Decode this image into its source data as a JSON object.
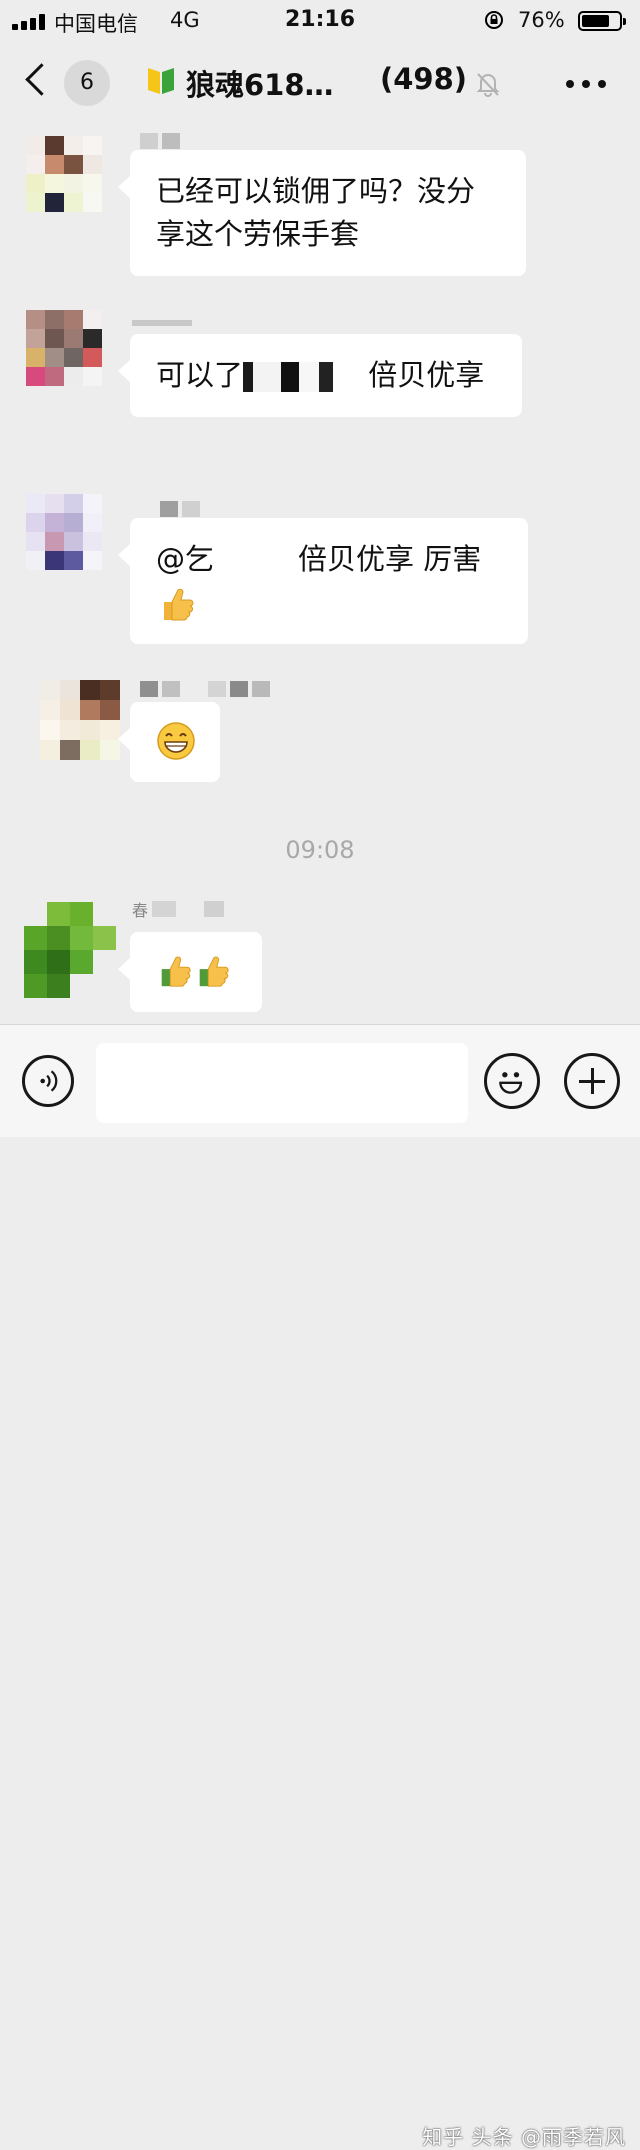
{
  "status_bar": {
    "carrier": "中国电信",
    "network": "4G",
    "time": "21:16",
    "battery": "76%",
    "battery_level": 0.76
  },
  "header": {
    "back_count": "6",
    "title": "狼魂618…",
    "member_count": "(498)",
    "icons": [
      "chevron-left-icon",
      "green-leaf-badge-icon",
      "mute-bell-icon",
      "more-dots-icon"
    ]
  },
  "messages": [
    {
      "text": "已经可以锁佣了吗？没分享这个劳保手套"
    },
    {
      "text_start": "可以了",
      "text_end": "倍贝优享"
    },
    {
      "text_start": "@乞",
      "text_end": "倍贝优享 厉害",
      "emoji": "thumbs-up-emoji"
    },
    {
      "emoji": "grinning-face-emoji"
    },
    {
      "sender_char": "春",
      "emojis": [
        "thumbs-up-emoji",
        "thumbs-up-emoji"
      ]
    }
  ],
  "timestamp": "09:08",
  "input_bar": {
    "placeholder": "",
    "icons": [
      "voice-icon",
      "emoji-icon",
      "plus-icon"
    ]
  },
  "watermark": "知乎 头条 @雨季若风",
  "colors": {
    "background": "#ededed",
    "bubble": "#ffffff",
    "timestamp": "#a8a8a8"
  }
}
